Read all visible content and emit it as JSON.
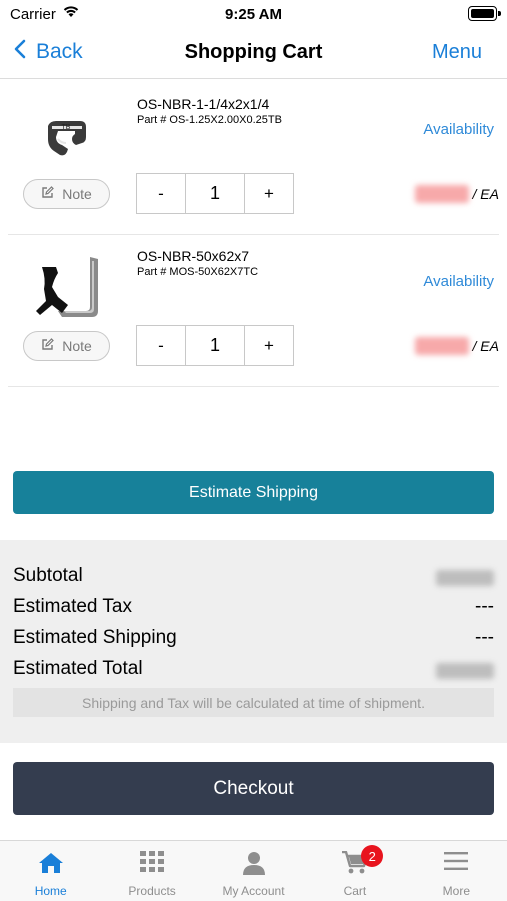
{
  "status": {
    "carrier": "Carrier",
    "time": "9:25 AM"
  },
  "nav": {
    "back_label": "Back",
    "title": "Shopping Cart",
    "menu_label": "Menu"
  },
  "items": [
    {
      "name": "OS-NBR-1-1/4x2x1/4",
      "part": "Part # OS-1.25X2.00X0.25TB",
      "availability": "Availability",
      "note_label": "Note",
      "quantity": "1",
      "minus": "-",
      "plus": "+",
      "unit": "/ EA"
    },
    {
      "name": "OS-NBR-50x62x7",
      "part": "Part # MOS-50X62X7TC",
      "availability": "Availability",
      "note_label": "Note",
      "quantity": "1",
      "minus": "-",
      "plus": "+",
      "unit": "/ EA"
    }
  ],
  "estimate_shipping_label": "Estimate Shipping",
  "summary": {
    "subtotal_label": "Subtotal",
    "tax_label": "Estimated Tax",
    "tax_value": "---",
    "shipping_label": "Estimated Shipping",
    "shipping_value": "---",
    "total_label": "Estimated Total",
    "notice": "Shipping and Tax will be calculated at time of shipment."
  },
  "checkout_label": "Checkout",
  "tabs": [
    {
      "label": "Home",
      "icon": "home-icon",
      "active": true
    },
    {
      "label": "Products",
      "icon": "grid-icon"
    },
    {
      "label": "My Account",
      "icon": "person-icon"
    },
    {
      "label": "Cart",
      "icon": "cart-icon",
      "badge": "2"
    },
    {
      "label": "More",
      "icon": "menu-lines-icon"
    }
  ],
  "colors": {
    "accent": "#1a7fd8",
    "estimate_button": "#17819a",
    "checkout_button": "#343d4f",
    "badge": "#e8141e"
  }
}
